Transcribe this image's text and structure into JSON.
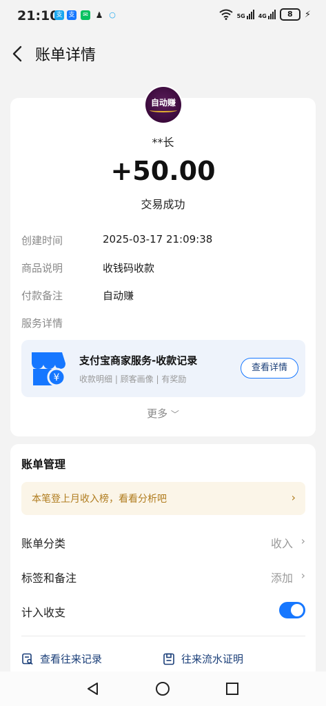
{
  "status_bar": {
    "time": "21:10",
    "battery": "8",
    "network_left": "5G",
    "network_right": "4G"
  },
  "header": {
    "title": "账单详情"
  },
  "transaction": {
    "avatar_text": "自动赚",
    "payer": "**长",
    "amount": "+50.00",
    "status": "交易成功",
    "details": [
      {
        "label": "创建时间",
        "value": "2025-03-17 21:09:38"
      },
      {
        "label": "商品说明",
        "value": "收钱码收款"
      },
      {
        "label": "付款备注",
        "value": "自动赚"
      },
      {
        "label": "服务详情",
        "value": ""
      }
    ],
    "service": {
      "title": "支付宝商家服务-收款记录",
      "subtitle": "收款明细 | 顾客画像 | 有奖励",
      "button": "查看详情"
    },
    "more": "更多"
  },
  "management": {
    "title": "账单管理",
    "promo": "本笔登上月收入榜，看看分析吧",
    "rows": [
      {
        "label": "账单分类",
        "value": "收入"
      },
      {
        "label": "标签和备注",
        "value": "添加"
      },
      {
        "label": "计入收支",
        "value": ""
      }
    ],
    "toggle_on": true,
    "links": [
      {
        "label": "查看往来记录"
      },
      {
        "label": "往来流水证明"
      }
    ]
  },
  "colors": {
    "accent": "#1677ff",
    "promo_bg": "#fbf5e8",
    "promo_text": "#b07c1e",
    "service_bg": "#eef3fb"
  }
}
